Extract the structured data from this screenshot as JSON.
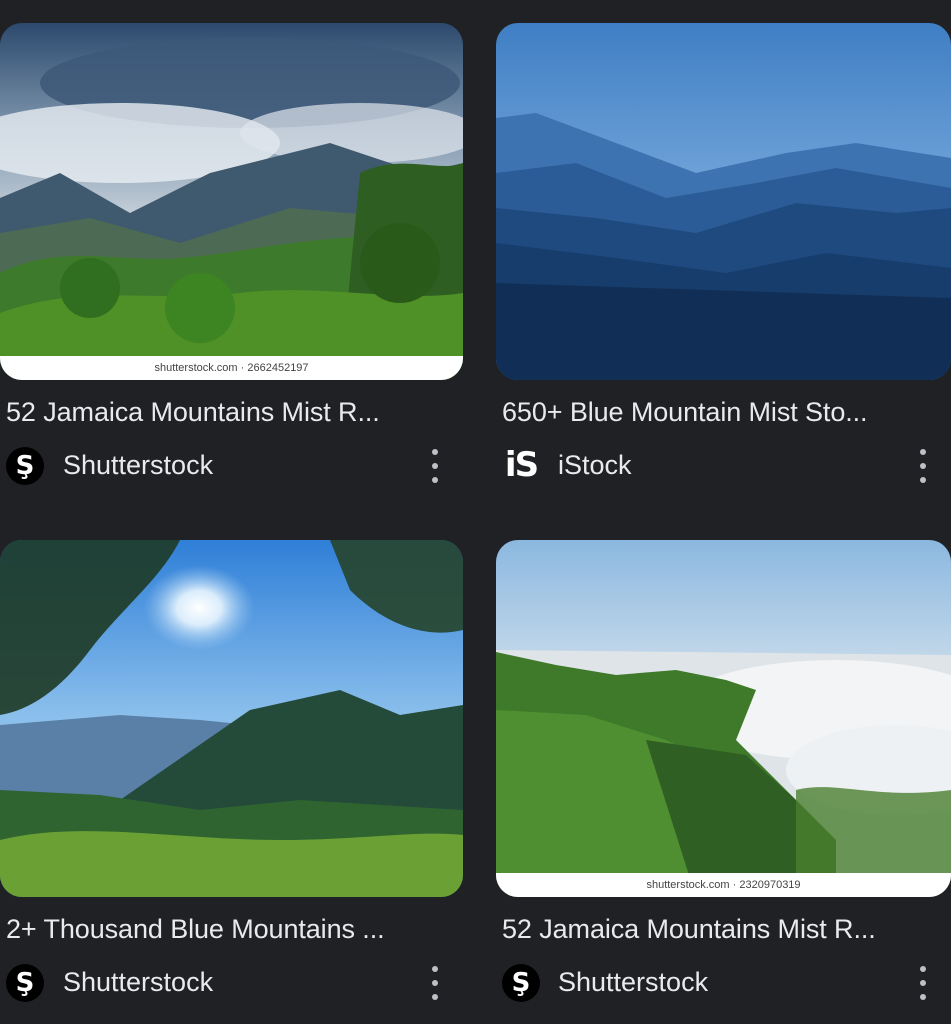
{
  "results": [
    {
      "title": "52 Jamaica Mountains Mist R...",
      "watermark": "shutterstock.com · 2662452197",
      "source": "Shutterstock",
      "favicon": "shutterstock-icon",
      "favicon_glyph": "Ş"
    },
    {
      "title": "650+ Blue Mountain Mist Sto...",
      "watermark": "",
      "source": "iStock",
      "favicon": "istock-icon",
      "favicon_glyph": "iS"
    },
    {
      "title": "2+ Thousand Blue Mountains ...",
      "watermark": "",
      "source": "Shutterstock",
      "favicon": "shutterstock-icon",
      "favicon_glyph": "Ş"
    },
    {
      "title": "52 Jamaica Mountains Mist R...",
      "watermark": "shutterstock.com · 2320970319",
      "source": "Shutterstock",
      "favicon": "shutterstock-icon",
      "favicon_glyph": "Ş"
    }
  ],
  "menu_icon": "more-vert-icon"
}
